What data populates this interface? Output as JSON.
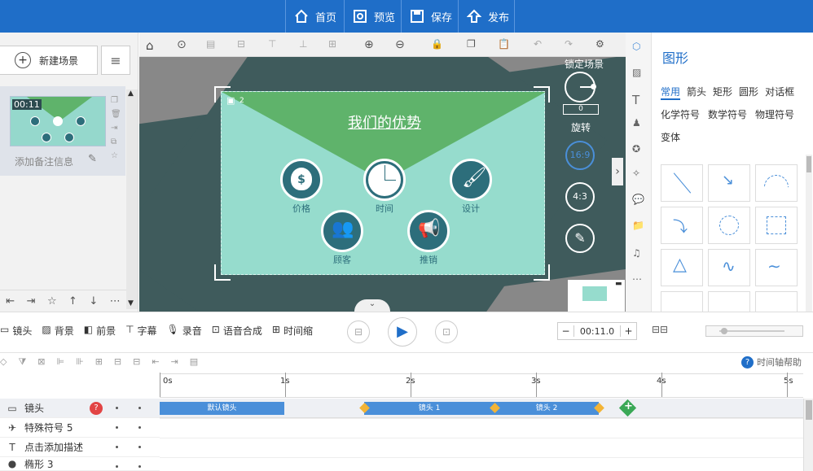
{
  "topbar": {
    "home": "首页",
    "preview": "预览",
    "save": "保存",
    "publish": "发布",
    "bg_color": "#1f6ec8"
  },
  "left": {
    "new_scene": "新建场景",
    "thumb_time": "00:11",
    "note_placeholder": "添加备注信息"
  },
  "canvas": {
    "title": "我们的优势",
    "camera_num": "2",
    "lock_scene": "锁定场景",
    "rotate_value": "0",
    "rotate_label": "旋转",
    "ratio_169": "16:9",
    "ratio_43": "4:3",
    "items": [
      "价格",
      "时间",
      "设计",
      "顾客",
      "推销"
    ]
  },
  "right": {
    "panel_title": "图形",
    "tabs": [
      "常用",
      "箭头",
      "矩形",
      "圆形",
      "对话框"
    ],
    "tabs2": [
      "化学符号",
      "数学符号",
      "物理符号"
    ],
    "tabs3": [
      "变体"
    ]
  },
  "controls": {
    "camera": "镜头",
    "bg": "背景",
    "fg": "前景",
    "subtitle": "字幕",
    "record": "录音",
    "tts": "语音合成",
    "timeline_zoom": "时间缩",
    "time": "00:11.0"
  },
  "timeline": {
    "help": "时间轴帮助",
    "ticks": [
      "0s",
      "1s",
      "2s",
      "3s",
      "4s",
      "5s"
    ],
    "rows": [
      "镜头",
      "特殊符号 5",
      "点击添加描述",
      "椭形 3"
    ],
    "clips": [
      "默认镜头",
      "镜头 1",
      "镜头 2"
    ]
  }
}
